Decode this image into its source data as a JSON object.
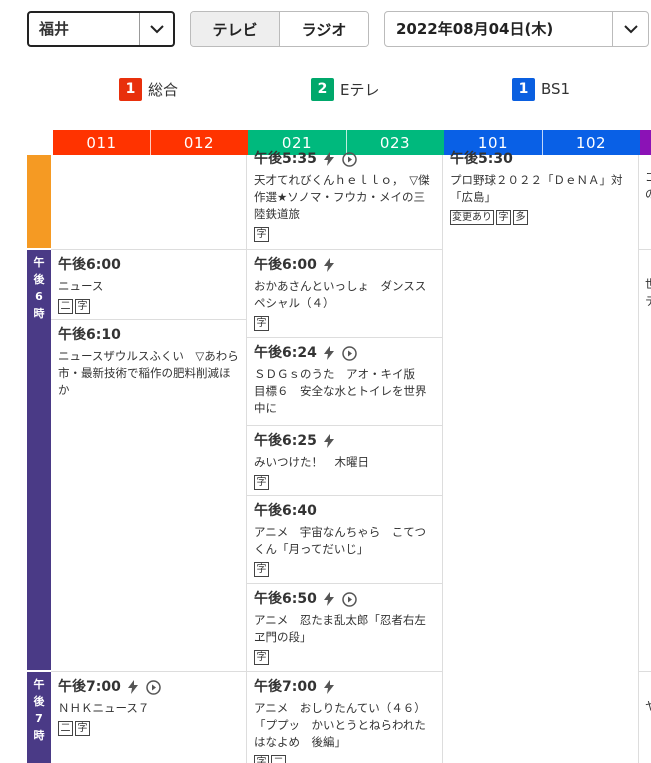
{
  "header": {
    "region": "福井",
    "media_tabs": [
      "テレビ",
      "ラジオ"
    ],
    "date": "2022年08月04日(木)"
  },
  "legend": [
    {
      "num": "1",
      "name": "総合",
      "color": "#e8300c"
    },
    {
      "num": "2",
      "name": "Eテレ",
      "color": "#00a86b"
    },
    {
      "num": "1",
      "name": "BS1",
      "color": "#0a5fe0"
    }
  ],
  "channels": [
    "011",
    "012",
    "021",
    "023",
    "101",
    "102"
  ],
  "colors": {
    "sogo": "#ff3300",
    "etele": "#00b97d",
    "bs1": "#0960e6",
    "bs_next": "#8b12b6",
    "hour5": "#f59a23",
    "hour67": "#4a3a86"
  },
  "hours": [
    {
      "label": [
        "午",
        "後",
        "6",
        "時"
      ]
    },
    {
      "label": [
        "午",
        "後",
        "7",
        "時"
      ]
    }
  ],
  "programs": {
    "sogo": [
      {
        "time": "午後6:00",
        "title": "ニュース",
        "tags": [
          "二",
          "字"
        ]
      },
      {
        "time": "午後6:10",
        "title": "ニュースザウルスふくい　▽あわら市・最新技術で稲作の肥料削減ほか",
        "tags": []
      },
      {
        "time": "午後7:00",
        "title": "ＮＨＫニュース７",
        "tags": [
          "二",
          "字"
        ]
      }
    ],
    "etele": [
      {
        "time": "午後5:35",
        "title": "天才てれびくんｈｅｌｌｏ，　▽傑作選★ソノマ・フウカ・メイの三陸鉄道旅",
        "tags": [
          "字"
        ]
      },
      {
        "time": "午後6:00",
        "title": "おかあさんといっしょ　ダンススペシャル（４）",
        "tags": [
          "字"
        ]
      },
      {
        "time": "午後6:24",
        "title": "ＳＤＧｓのうた　アオ・キイ版　目標６　安全な水とトイレを世界中に",
        "tags": []
      },
      {
        "time": "午後6:25",
        "title": "みいつけた！　木曜日",
        "tags": [
          "字"
        ]
      },
      {
        "time": "午後6:40",
        "title": "アニメ　宇宙なんちゃら　こてつくん「月ってだいじ」",
        "tags": [
          "字"
        ]
      },
      {
        "time": "午後6:50",
        "title": "アニメ　忍たま乱太郎「忍者右左ヱ門の段」",
        "tags": [
          "字"
        ]
      },
      {
        "time": "午後7:00",
        "title": "アニメ　おしりたんてい（４６）「ププッ　かいとうとねらわれたはなよめ　後編」",
        "tags": [
          "字",
          "二"
        ]
      }
    ],
    "bs1": [
      {
        "time": "午後5:30",
        "title": "プロ野球２０２２「ＤｅＮＡ」対「広島」",
        "tags": [
          "変更あり",
          "字",
          "多"
        ]
      }
    ],
    "bs_next": [
      {
        "text": "コ"
      },
      {
        "text": "の"
      },
      {
        "text": "世"
      },
      {
        "text": "テ"
      },
      {
        "text": "ヤ"
      }
    ]
  }
}
